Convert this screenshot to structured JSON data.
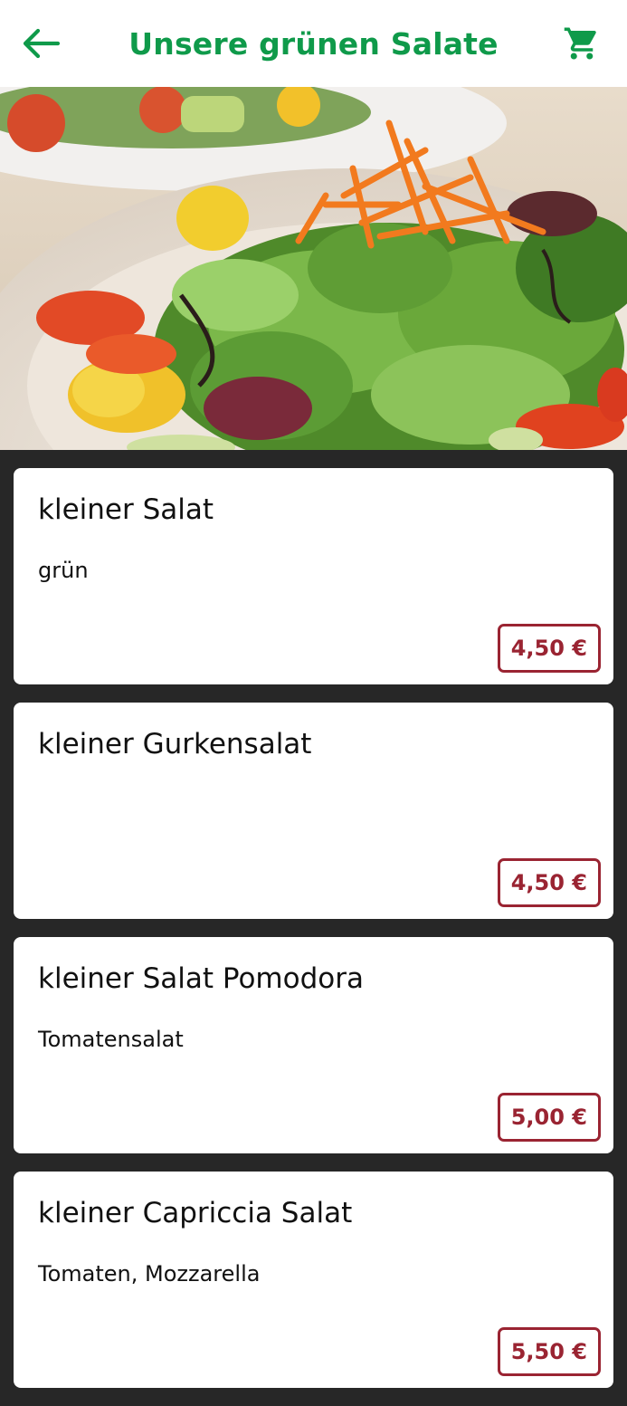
{
  "header": {
    "title": "Unsere grünen Salate",
    "back_icon": "arrow-left-icon",
    "cart_icon": "shopping-cart-icon",
    "accent_color": "#0f9a4a"
  },
  "hero": {
    "image_name": "salad-photo"
  },
  "items": [
    {
      "title": "kleiner Salat",
      "description": "grün",
      "price": "4,50 €"
    },
    {
      "title": "kleiner Gurkensalat",
      "description": "",
      "price": "4,50 €"
    },
    {
      "title": "kleiner Salat Pomodora",
      "description": "Tomatensalat",
      "price": "5,00 €"
    },
    {
      "title": "kleiner Capriccia Salat",
      "description": "Tomaten, Mozzarella",
      "price": "5,50 €"
    }
  ],
  "colors": {
    "price": "#9a2432",
    "background": "#272727"
  }
}
